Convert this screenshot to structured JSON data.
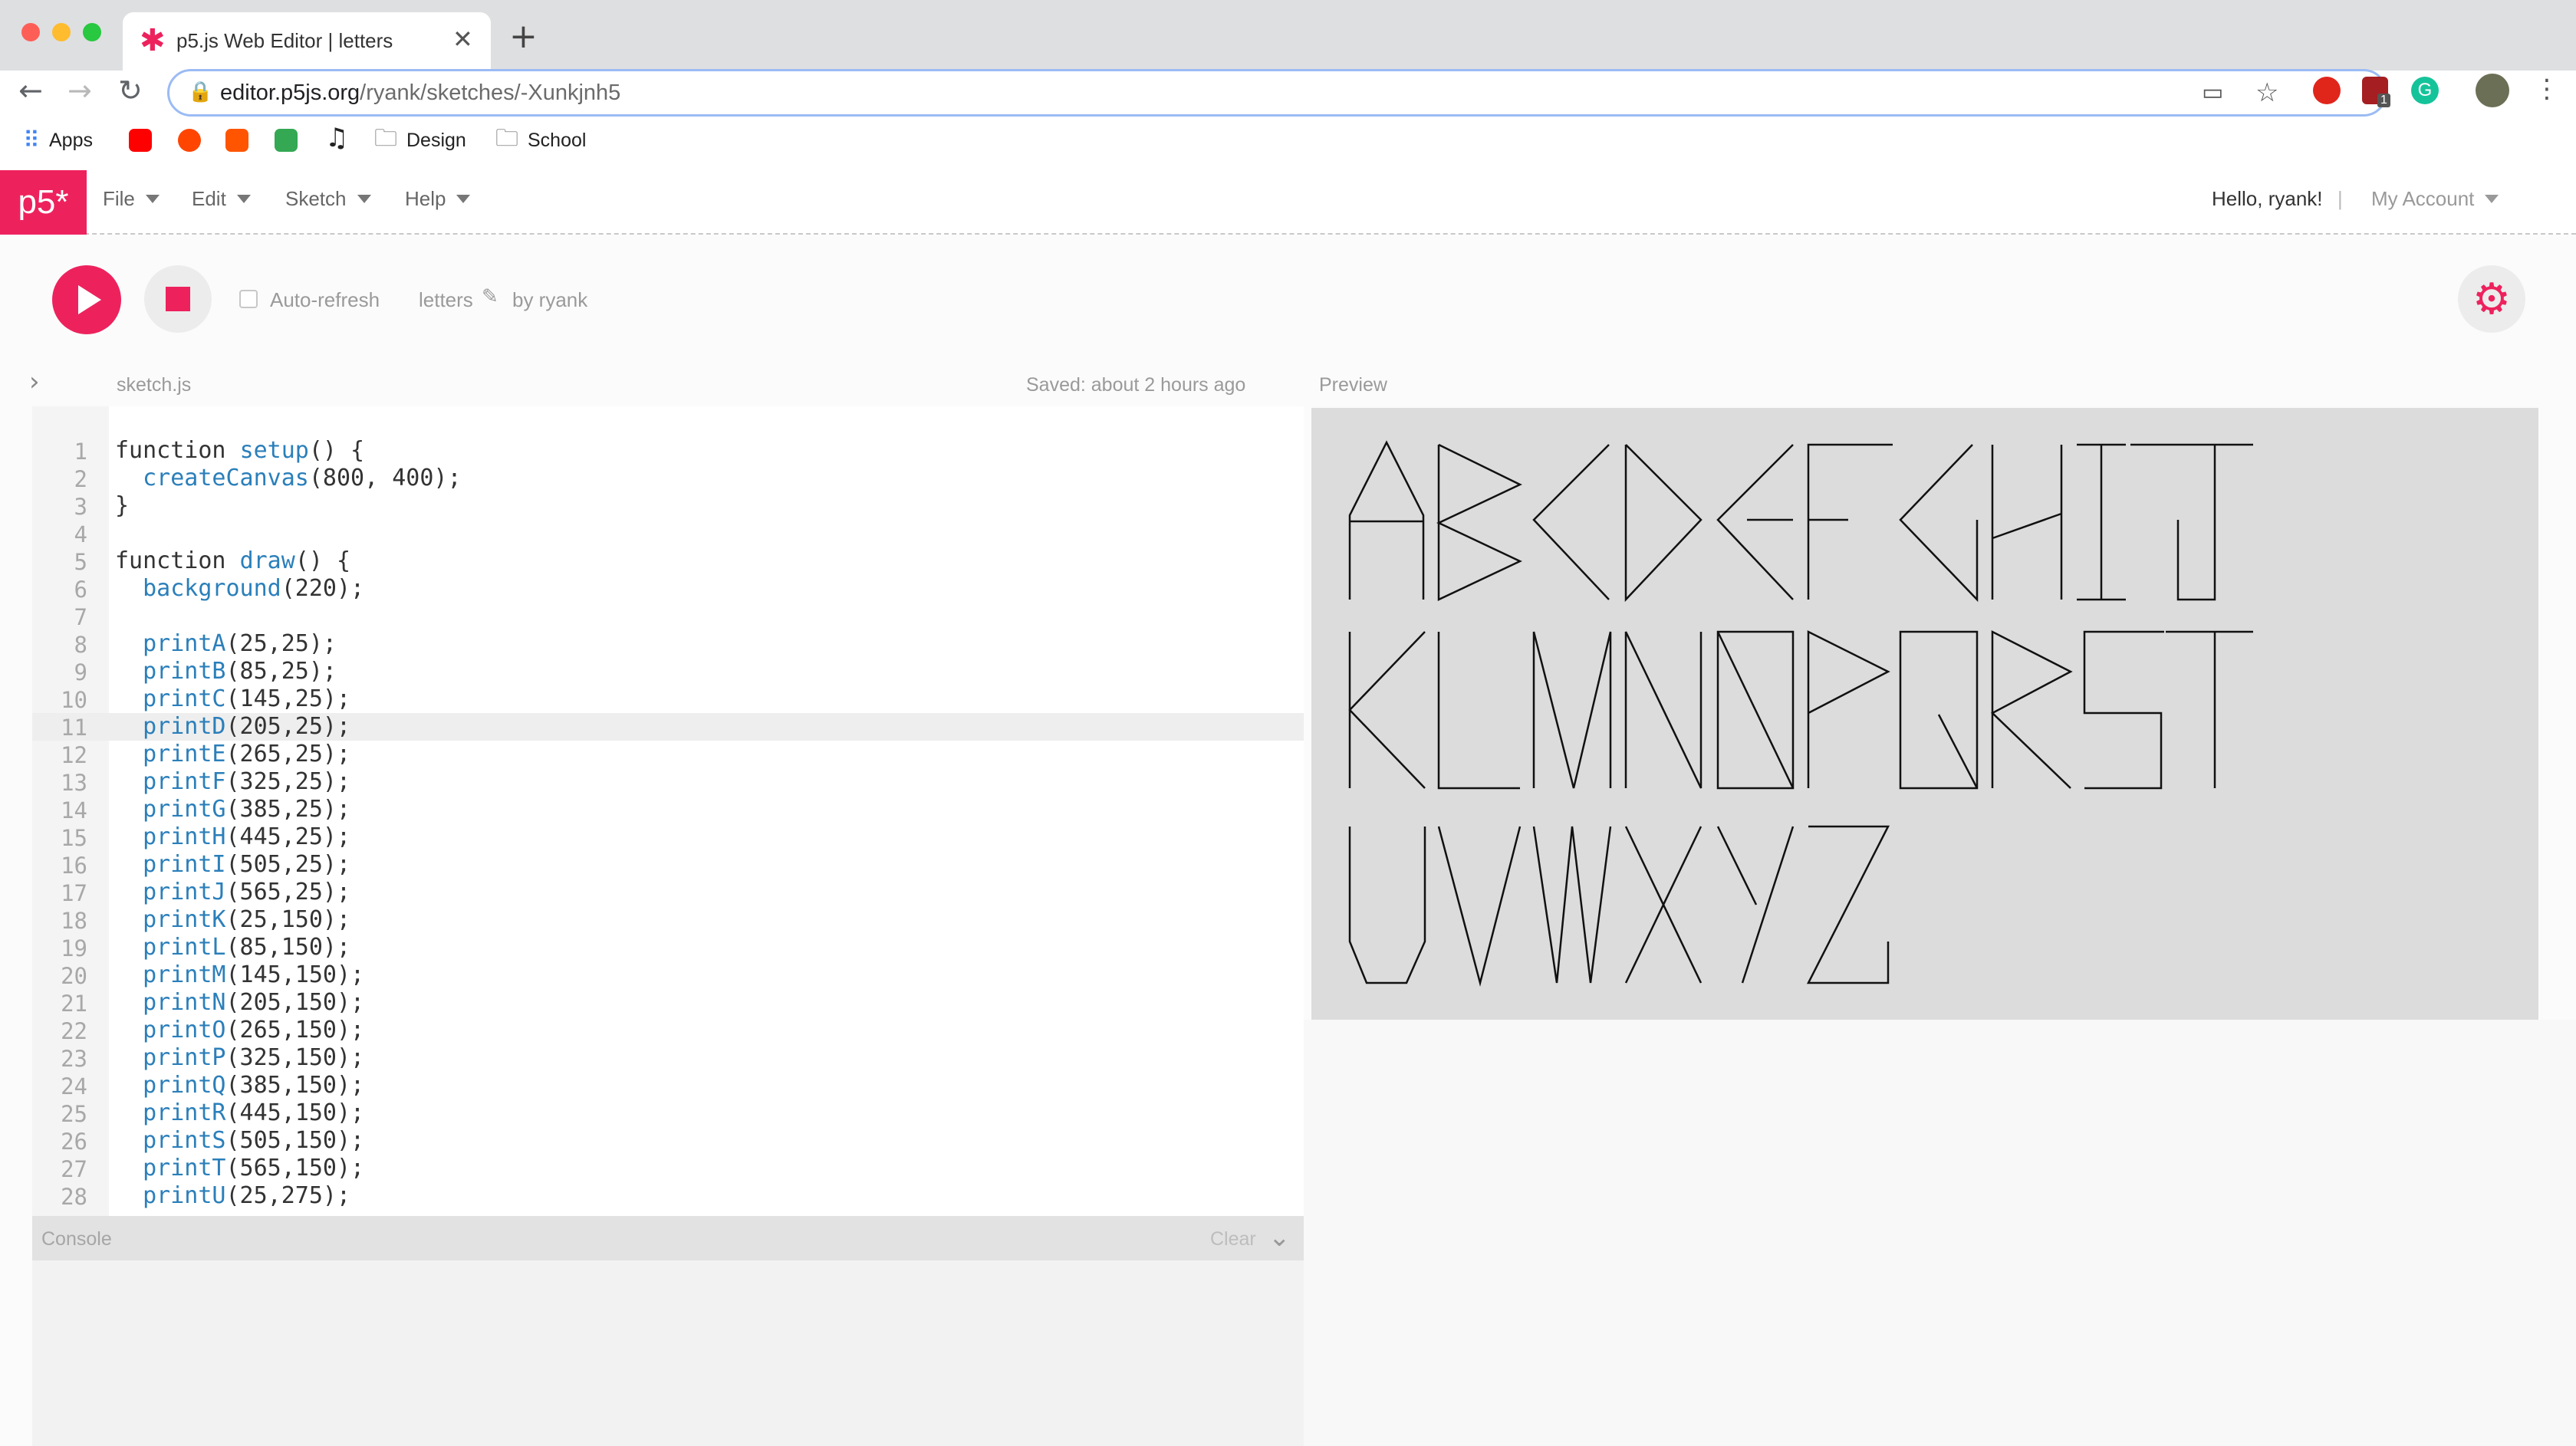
{
  "browser": {
    "tab_title": "p5.js Web Editor | letters",
    "url_host": "editor.p5js.org",
    "url_path": "/ryank/sketches/-Xunkjnh5",
    "bookmarks": [
      {
        "label": "Apps"
      },
      {
        "label": "Design"
      },
      {
        "label": "School"
      }
    ],
    "extension_badge": "1"
  },
  "app": {
    "logo_text": "p5*",
    "menus": [
      "File",
      "Edit",
      "Sketch",
      "Help"
    ],
    "greeting": "Hello, ryank!",
    "separator": "|",
    "account_label": "My Account",
    "accent": "#ed225d"
  },
  "toolbar": {
    "auto_refresh_label": "Auto-refresh",
    "auto_refresh_checked": false,
    "sketch_name": "letters",
    "author": "by ryank"
  },
  "editor": {
    "file_name": "sketch.js",
    "saved_status": "Saved: about 2 hours ago",
    "highlighted_line": 11,
    "lines": [
      {
        "n": "1",
        "t": "function setup() {"
      },
      {
        "n": "2",
        "t": "  createCanvas(800, 400);"
      },
      {
        "n": "3",
        "t": "}"
      },
      {
        "n": "4",
        "t": ""
      },
      {
        "n": "5",
        "t": "function draw() {"
      },
      {
        "n": "6",
        "t": "  background(220);"
      },
      {
        "n": "7",
        "t": ""
      },
      {
        "n": "8",
        "t": "  printA(25,25);"
      },
      {
        "n": "9",
        "t": "  printB(85,25);"
      },
      {
        "n": "10",
        "t": "  printC(145,25);"
      },
      {
        "n": "11",
        "t": "  printD(205,25);"
      },
      {
        "n": "12",
        "t": "  printE(265,25);"
      },
      {
        "n": "13",
        "t": "  printF(325,25);"
      },
      {
        "n": "14",
        "t": "  printG(385,25);"
      },
      {
        "n": "15",
        "t": "  printH(445,25);"
      },
      {
        "n": "16",
        "t": "  printI(505,25);"
      },
      {
        "n": "17",
        "t": "  printJ(565,25);"
      },
      {
        "n": "18",
        "t": "  printK(25,150);"
      },
      {
        "n": "19",
        "t": "  printL(85,150);"
      },
      {
        "n": "20",
        "t": "  printM(145,150);"
      },
      {
        "n": "21",
        "t": "  printN(205,150);"
      },
      {
        "n": "22",
        "t": "  printO(265,150);"
      },
      {
        "n": "23",
        "t": "  printP(325,150);"
      },
      {
        "n": "24",
        "t": "  printQ(385,150);"
      },
      {
        "n": "25",
        "t": "  printR(445,150);"
      },
      {
        "n": "26",
        "t": "  printS(505,150);"
      },
      {
        "n": "27",
        "t": "  printT(565,150);"
      },
      {
        "n": "28",
        "t": "  printU(25,275);"
      }
    ]
  },
  "console": {
    "title": "Console",
    "clear_label": "Clear"
  },
  "preview": {
    "title": "Preview"
  }
}
